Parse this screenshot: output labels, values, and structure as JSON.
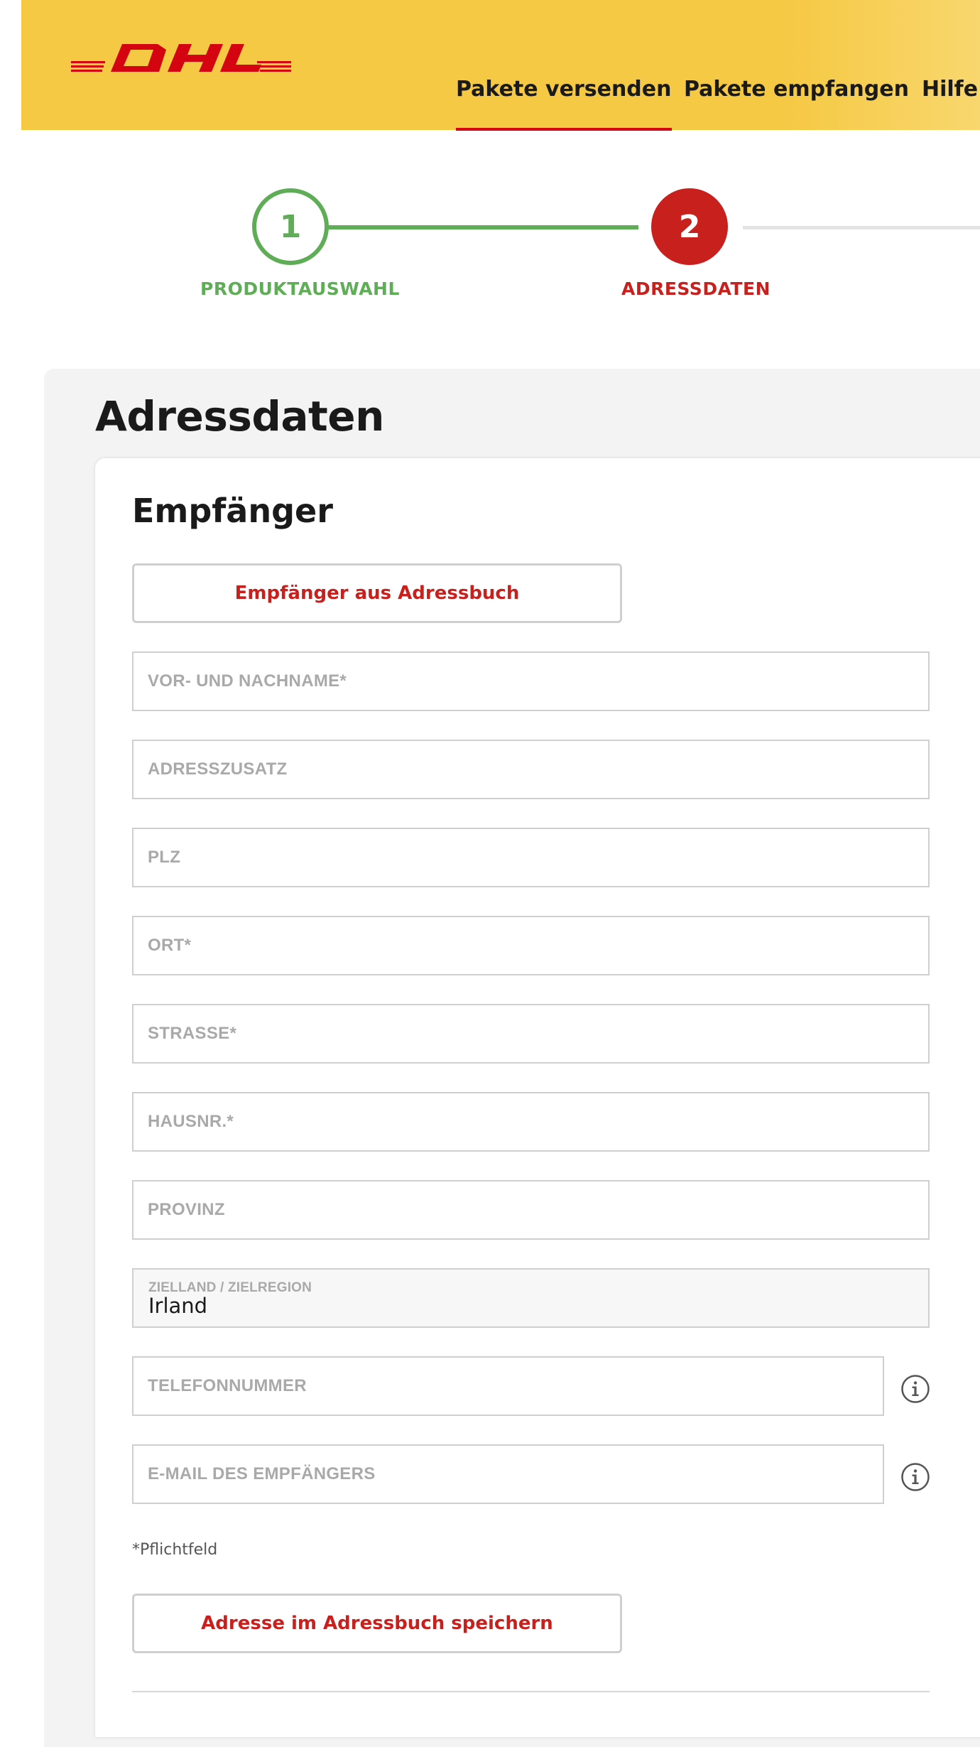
{
  "header": {
    "logo_text": "DHL",
    "nav": [
      {
        "label": "Pakete versenden",
        "active": true
      },
      {
        "label": "Pakete empfangen",
        "active": false
      },
      {
        "label": "Hilfe u",
        "active": false
      }
    ]
  },
  "stepper": {
    "steps": [
      {
        "number": "1",
        "label": "PRODUKTAUSWAHL",
        "state": "done"
      },
      {
        "number": "2",
        "label": "ADRESSDATEN",
        "state": "current"
      }
    ]
  },
  "page": {
    "title": "Adressdaten"
  },
  "recipient": {
    "title": "Empfänger",
    "address_book_button": "Empfänger aus Adressbuch",
    "fields": {
      "name": {
        "placeholder": "VOR- UND NACHNAME*"
      },
      "address_extra": {
        "placeholder": "ADRESSZUSATZ"
      },
      "zip": {
        "placeholder": "PLZ"
      },
      "city": {
        "placeholder": "ORT*"
      },
      "street": {
        "placeholder": "STRASSE*"
      },
      "house_no": {
        "placeholder": "HAUSNR.*"
      },
      "province": {
        "placeholder": "PROVINZ"
      },
      "country": {
        "label": "ZIELLAND / ZIELREGION",
        "value": "Irland"
      },
      "phone": {
        "placeholder": "TELEFONNUMMER"
      },
      "email": {
        "placeholder": "E-MAIL DES EMPFÄNGERS"
      }
    },
    "required_note": "*Pflichtfeld",
    "save_button": "Adresse im Adressbuch speichern"
  },
  "colors": {
    "brand_yellow": "#f6c944",
    "brand_red": "#d40511",
    "success_green": "#5fad56",
    "active_red": "#c8201d"
  },
  "icons": {
    "info": "info-icon"
  }
}
